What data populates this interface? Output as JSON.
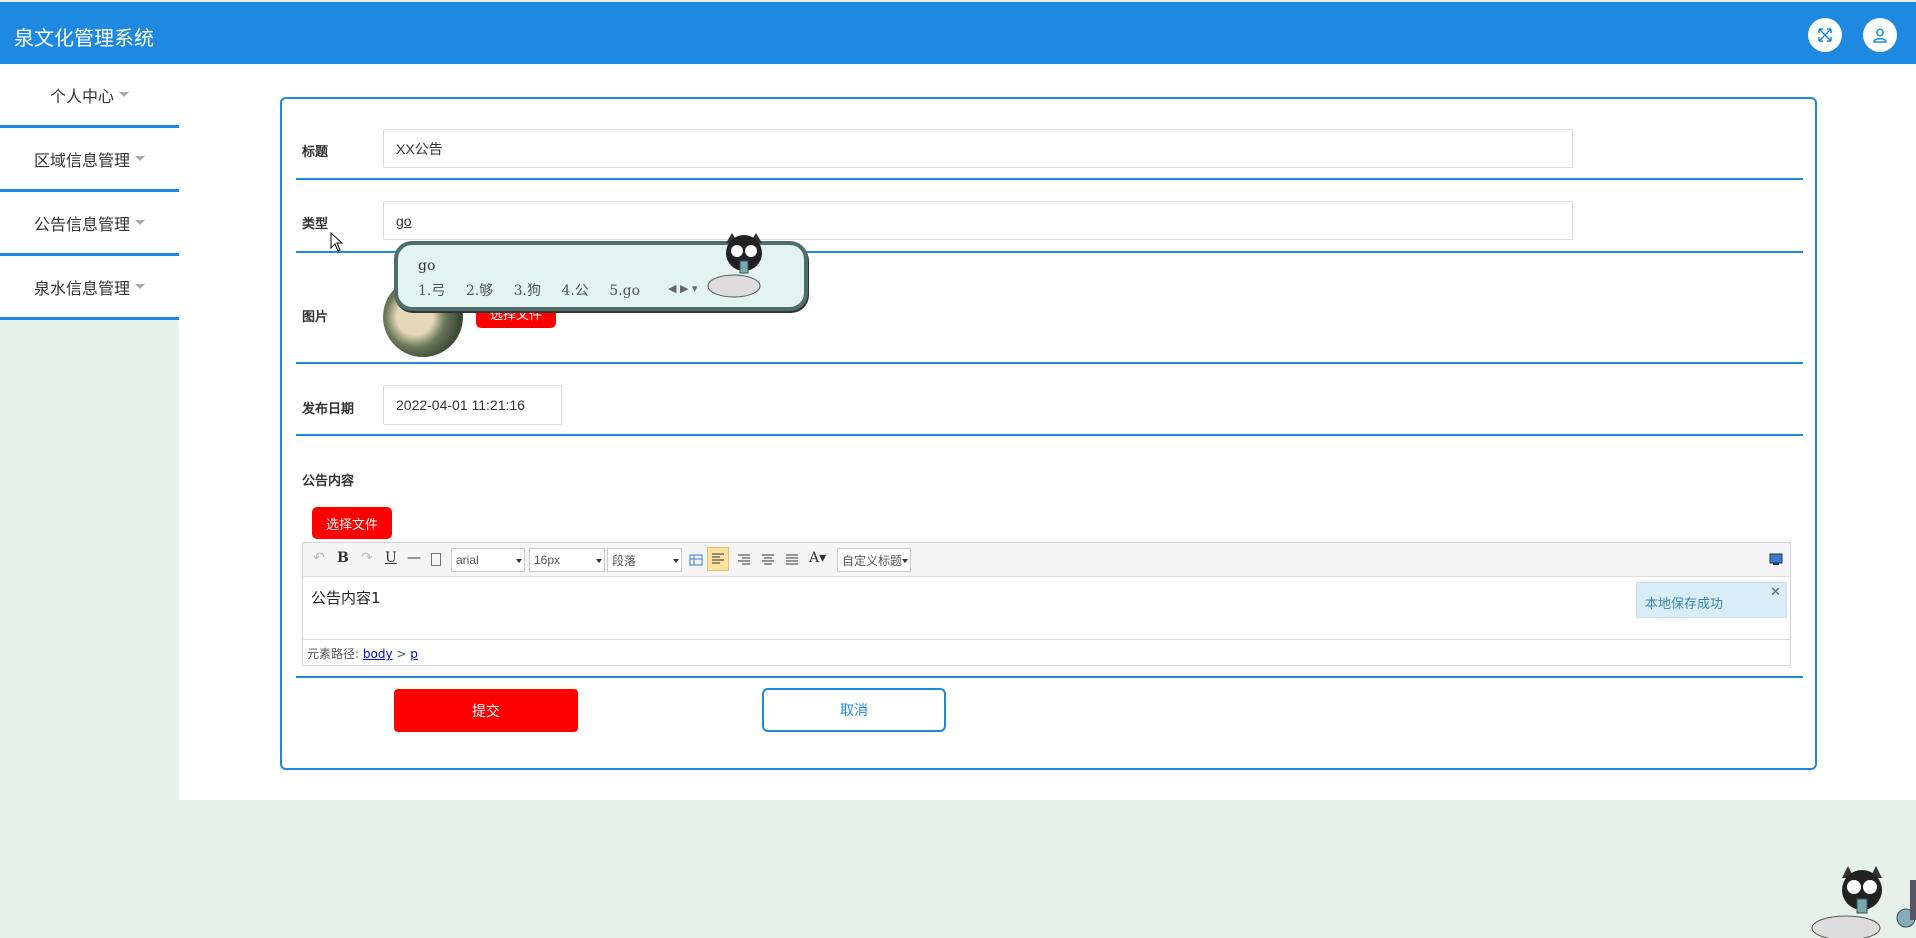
{
  "header": {
    "title": "泉文化管理系统",
    "fullscreen_icon": "expand-icon",
    "user_icon": "user-icon"
  },
  "sidebar": {
    "items": [
      {
        "label": "个人中心"
      },
      {
        "label": "区域信息管理"
      },
      {
        "label": "公告信息管理"
      },
      {
        "label": "泉水信息管理"
      }
    ]
  },
  "form": {
    "title_label": "标题",
    "title_value": "XX公告",
    "type_label": "类型",
    "type_value": "go",
    "image_label": "图片",
    "image_button": "选择文件",
    "date_label": "发布日期",
    "date_value": "2022-04-01 11:21:16",
    "content_label": "公告内容",
    "content_file_button": "选择文件",
    "submit_label": "提交",
    "cancel_label": "取消"
  },
  "ime": {
    "input": "go",
    "candidates": [
      "1.弓",
      "2.够",
      "3.狗",
      "4.公",
      "5.go"
    ]
  },
  "editor": {
    "font_family": "arial",
    "font_size": "16px",
    "paragraph": "段落",
    "custom_title": "自定义标题",
    "content": "公告内容1",
    "saved_tip": "本地保存成功",
    "path_prefix": "元素路径:",
    "path_body": "body",
    "path_sep": ">",
    "path_p": "p"
  },
  "colors": {
    "accent": "#1d89e0",
    "danger": "#ff0000",
    "background": "#e6f1ea"
  }
}
